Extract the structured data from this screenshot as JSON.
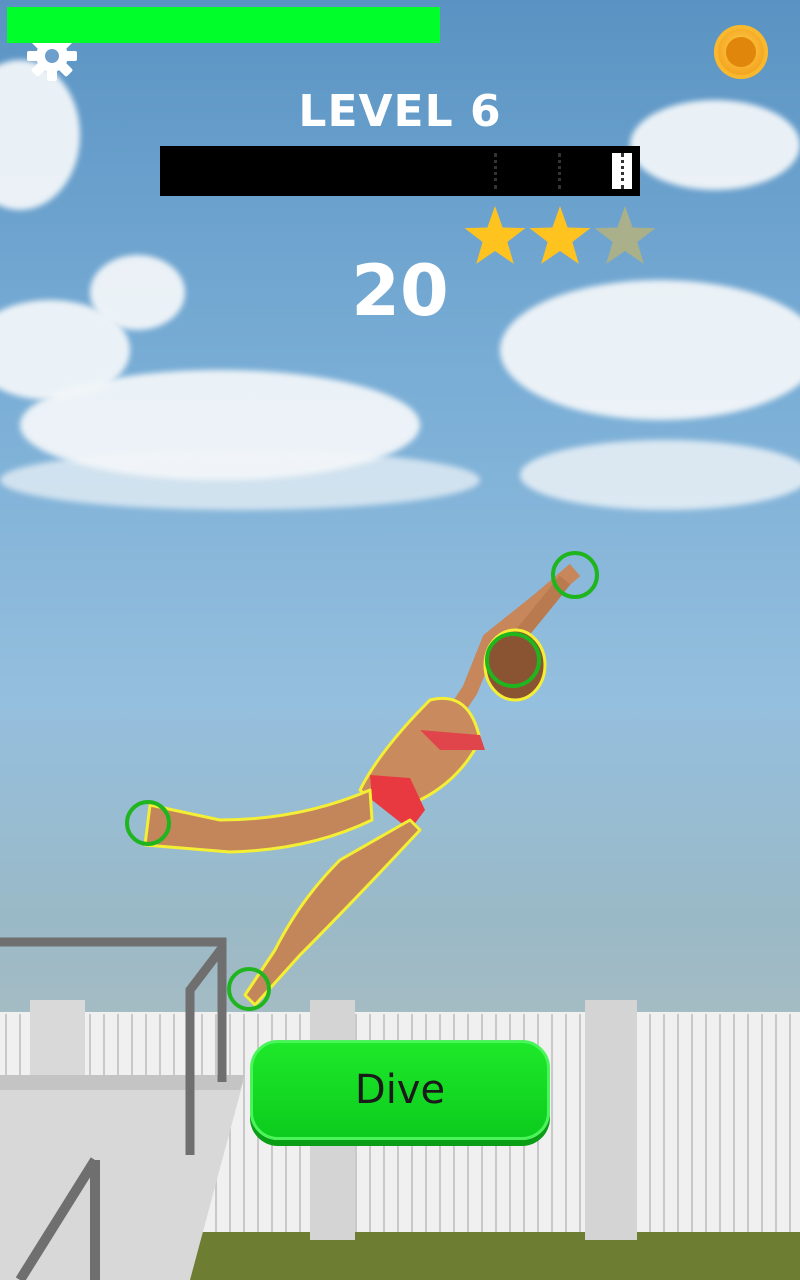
{
  "hud": {
    "level_title": "LEVEL 6",
    "score": "20",
    "progress_fraction": 0.93,
    "stars_earned": 2,
    "stars_total": 3
  },
  "buttons": {
    "dive_label": "Dive",
    "settings_icon": "gear-icon",
    "coin_icon": "coin-icon"
  },
  "colors": {
    "progress_fill": "#00ff2a",
    "star_filled": "#ffc31f",
    "star_empty": "#a9b08a",
    "dive_button": "#0ccc1d"
  }
}
